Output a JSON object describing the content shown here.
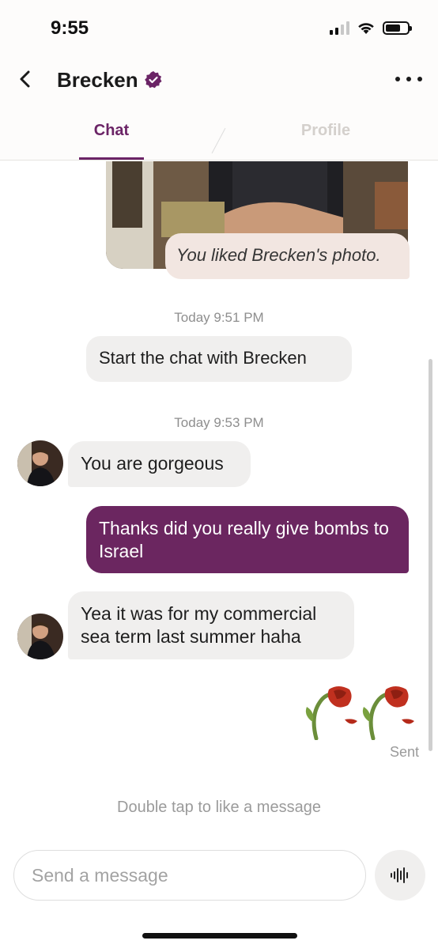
{
  "status_bar": {
    "time": "9:55",
    "icons": [
      "signal-icon",
      "wifi-icon",
      "battery-icon"
    ]
  },
  "header": {
    "back_icon": "chevron-left-icon",
    "name": "Brecken",
    "verified_icon": "verified-badge-icon",
    "more_icon": "more-dots-icon"
  },
  "tabs": [
    {
      "label": "Chat",
      "active": true
    },
    {
      "label": "Profile",
      "active": false
    }
  ],
  "messages": {
    "photo_like": "You liked Brecken's photo.",
    "timestamp_1": "Today 9:51 PM",
    "system_prompt": "Start the chat with Brecken",
    "timestamp_2": "Today 9:53 PM",
    "incoming_1": "You are gorgeous",
    "outgoing_1": "Thanks did you really give bombs to Israel",
    "incoming_2": "Yea it was for my commercial sea term last summer haha",
    "outgoing_sticker": "wilted-rose-emoji x2",
    "sent_status": "Sent"
  },
  "hint": "Double tap to like a message",
  "composer": {
    "placeholder": "Send a message",
    "voice_icon": "voice-waveform-icon"
  },
  "colors": {
    "accent": "#6b2466",
    "outgoing_bubble": "#6b2660",
    "incoming_bubble": "#f0efee",
    "like_bubble": "#f2e6e1"
  }
}
